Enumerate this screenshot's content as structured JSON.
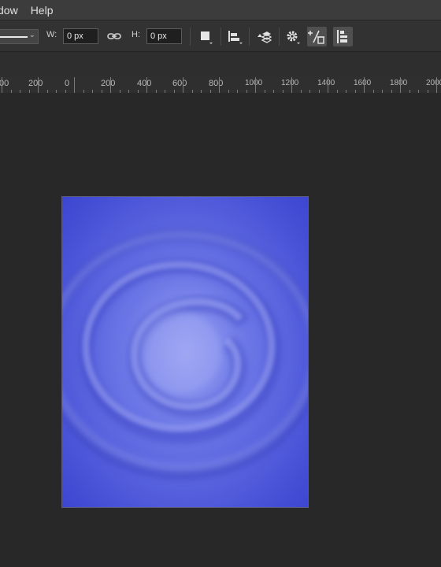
{
  "menu": {
    "items": [
      "dow",
      "Help"
    ]
  },
  "options": {
    "width_label": "W:",
    "width_value": "0 px",
    "height_label": "H:",
    "height_value": "0 px"
  },
  "ruler": {
    "labels": [
      "00",
      "200",
      "0",
      "200",
      "400",
      "600",
      "800",
      "1000",
      "1200",
      "1400",
      "1600",
      "1800",
      "2000"
    ]
  },
  "colors": {
    "document_bg": "#3f48d0",
    "swirl_light": "#8c96ee",
    "pasteboard": "#282828"
  },
  "icons": [
    "chevron-down-icon",
    "link-icon",
    "path-operations-icon",
    "path-alignment-icon",
    "path-arrangement-icon",
    "gear-icon",
    "constrain-path-icon",
    "align-edges-icon"
  ]
}
